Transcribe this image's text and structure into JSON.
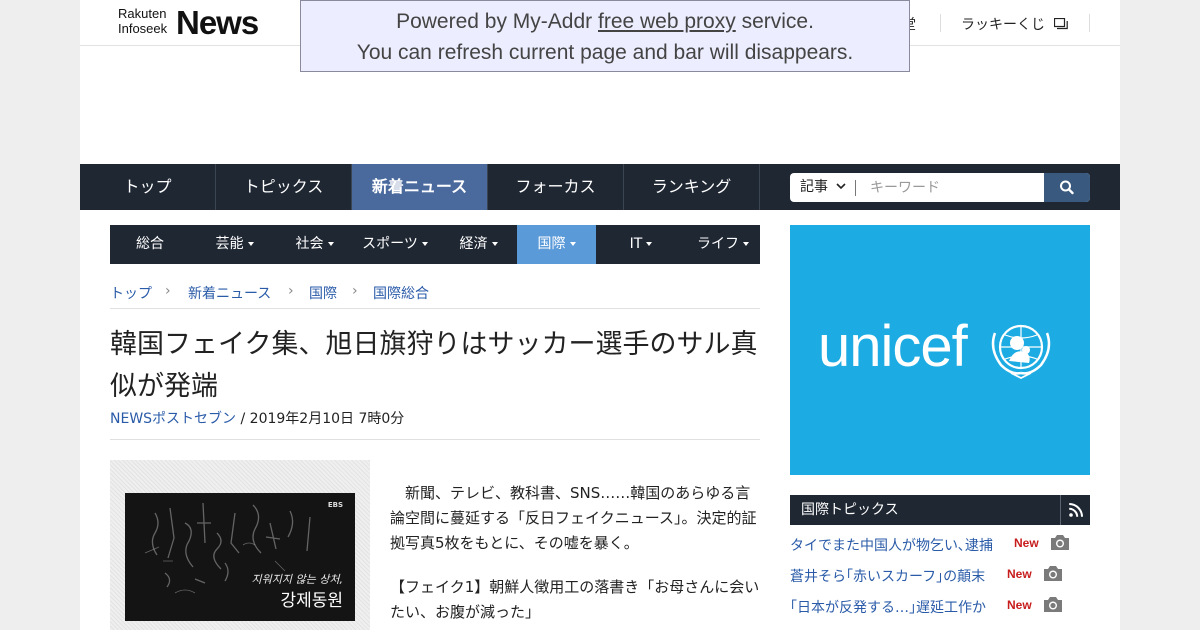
{
  "header": {
    "logo_small": "Rakuten Infoseek",
    "logo_big": "News",
    "partial_link": "堂",
    "lottery_label": "ラッキーくじ"
  },
  "proxy_banner": {
    "line1_before": "Powered by My-Addr ",
    "line1_link": "free web proxy",
    "line1_after": " service.",
    "line2": "You can refresh current page and bar will disappears."
  },
  "main_nav": {
    "items": [
      {
        "label": "トップ"
      },
      {
        "label": "トピックス"
      },
      {
        "label": "新着ニュース",
        "active": true
      },
      {
        "label": "フォーカス"
      },
      {
        "label": "ランキング"
      }
    ],
    "search": {
      "category": "記事",
      "placeholder": "キーワード"
    }
  },
  "sub_nav": {
    "items": [
      {
        "label": "総合"
      },
      {
        "label": "芸能"
      },
      {
        "label": "社会"
      },
      {
        "label": "スポーツ"
      },
      {
        "label": "経済"
      },
      {
        "label": "国際",
        "active": true
      },
      {
        "label": "IT"
      },
      {
        "label": "ライフ"
      }
    ]
  },
  "breadcrumb": [
    "トップ",
    "新着ニュース",
    "国際",
    "国際総合"
  ],
  "article": {
    "title": "韓国フェイク集、旭日旗狩りはサッカー選手のサル真似が発端",
    "source": "NEWSポストセブン",
    "date": " / 2019年2月10日 7時0分",
    "photo": {
      "broadcaster": "EBS",
      "caption_small": "지워지지 않는 상처,",
      "caption_big": "강제동원"
    },
    "paragraphs": [
      "　新聞、テレビ、教科書、SNS……韓国のあらゆる言論空間に蔓延する「反日フェイクニュース」。決定的証拠写真5枚をもとに、その嘘を暴く。",
      "【フェイク1】朝鮮人徴用工の落書き「お母さんに会いたい、お腹が減った」"
    ]
  },
  "sidebar": {
    "ad_text": "unicef",
    "topics_title": "国際トピックス",
    "topics": [
      {
        "title": "タイでまた中国人が物乞い､逮捕",
        "badge": "New"
      },
      {
        "title": "蒼井そら｢赤いスカーフ｣の顛末",
        "badge": "New"
      },
      {
        "title": "｢日本が反発する…｣遅延工作か",
        "badge": "New"
      }
    ]
  },
  "colors": {
    "nav_bg": "#1f2733",
    "nav_active": "#4a6a9e",
    "subnav_active": "#5b9ad9",
    "link": "#2a5ba8",
    "unicef_blue": "#1cabe2",
    "new_badge": "#c81d1d"
  }
}
